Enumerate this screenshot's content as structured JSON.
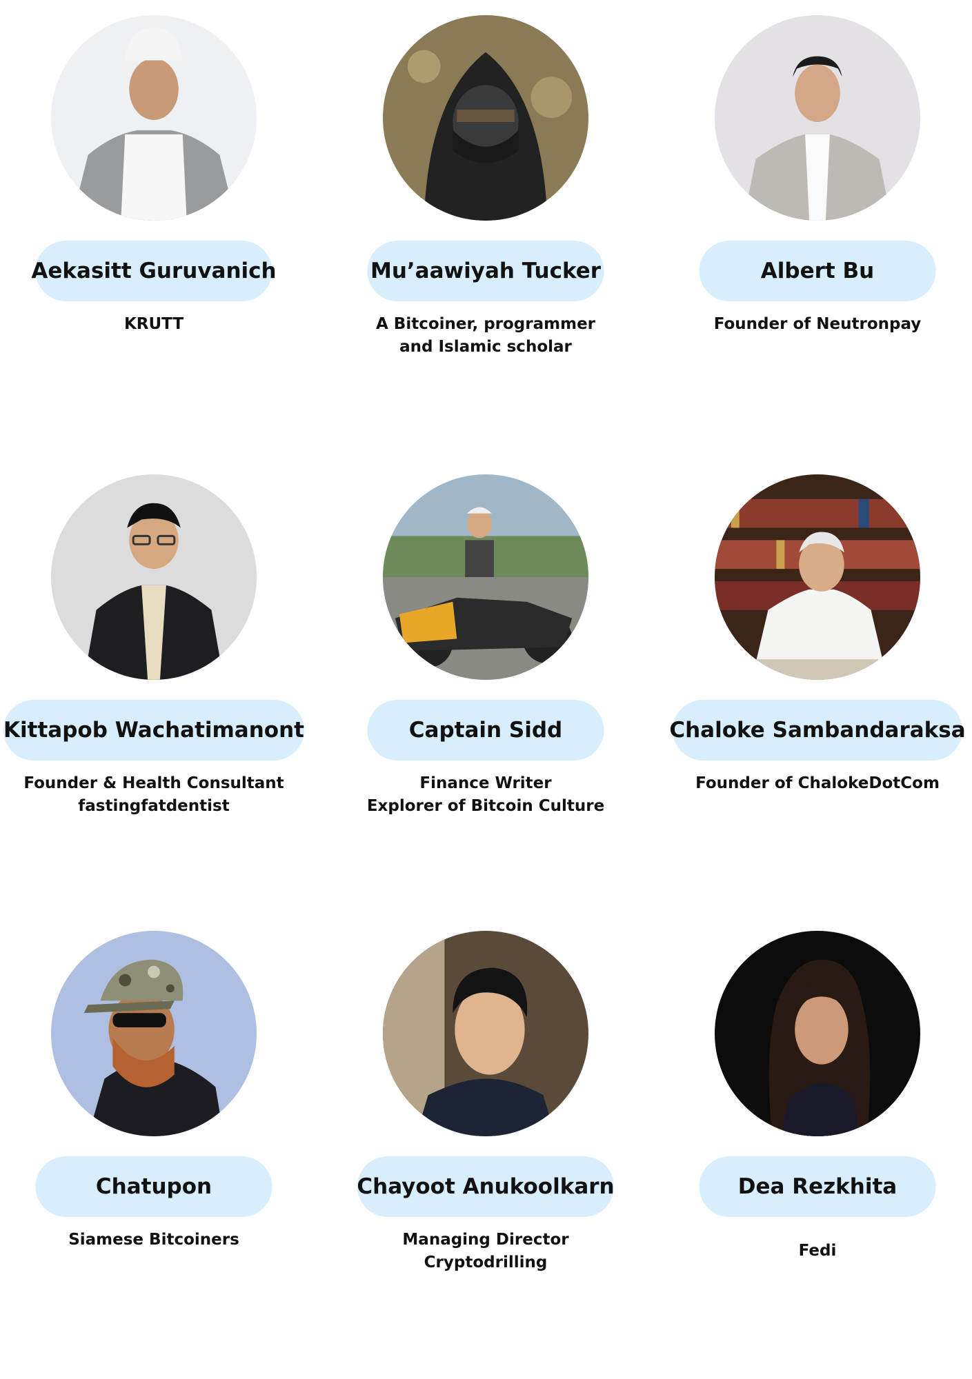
{
  "speakers": [
    {
      "name": "Aekasitt Guruvanich",
      "role_lines": [
        "KRUTT",
        ""
      ],
      "photo_icon": "portrait-chef-hat"
    },
    {
      "name": "Mu’aawiyah Tucker",
      "role_lines": [
        "A Bitcoiner, programmer",
        "and Islamic scholar"
      ],
      "photo_icon": "portrait-hooded-masked"
    },
    {
      "name": "Albert Bu",
      "role_lines": [
        "Founder of Neutronpay",
        ""
      ],
      "photo_icon": "portrait-grey-blazer"
    },
    {
      "name": "Kittapob  Wachatimanont",
      "role_lines": [
        "Founder & Health Consultant",
        "fastingfatdentist"
      ],
      "photo_icon": "portrait-dark-suit-glasses"
    },
    {
      "name": "Captain Sidd",
      "role_lines": [
        "Finance Writer",
        "Explorer of Bitcoin Culture"
      ],
      "photo_icon": "portrait-motorcycle"
    },
    {
      "name": "Chaloke Sambandaraksa",
      "role_lines": [
        "Founder of ChalokeDotCom",
        ""
      ],
      "photo_icon": "portrait-bookshelf"
    },
    {
      "name": "Chatupon",
      "role_lines": [
        "Siamese Bitcoiners",
        ""
      ],
      "photo_icon": "portrait-camo-cap-mask"
    },
    {
      "name": "Chayoot Anukoolkarn",
      "role_lines": [
        "Managing Director",
        "Cryptodrilling"
      ],
      "photo_icon": "portrait-smiling-man"
    },
    {
      "name": "Dea Rezkhita",
      "role_lines": [
        "Fedi",
        ""
      ],
      "photo_icon": "portrait-woman-dark-bg"
    }
  ],
  "colors": {
    "pill_bg": "#d8eefc",
    "text": "#111111",
    "background": "#ffffff"
  }
}
